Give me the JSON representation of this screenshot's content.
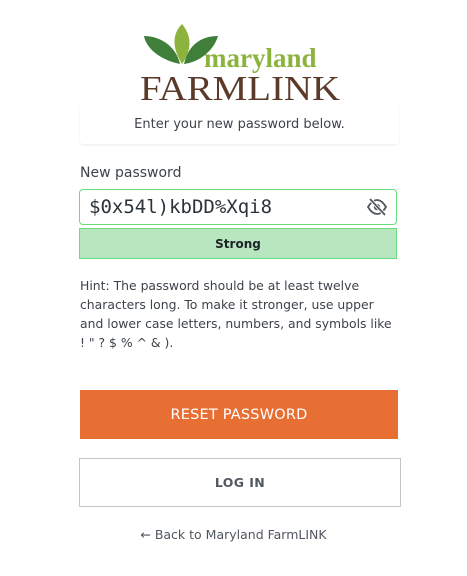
{
  "logo": {
    "word_top": "maryland",
    "word_bottom": "FARMLINK",
    "top_color": "#8db33f",
    "bottom_color": "#5b3a29",
    "leaf_dark": "#3f7f3a",
    "leaf_light": "#8db33f"
  },
  "message": "Enter your new password below.",
  "password": {
    "label": "New password",
    "value": "$0x54l)kbDD%Xqi8",
    "toggle_icon": "eye-slash-icon"
  },
  "strength": {
    "label": "Strong",
    "color": "#b8e6bf"
  },
  "hint": "Hint: The password should be at least twelve characters long. To make it stronger, use upper and lower case letters, numbers, and symbols like ! \" ? $ % ^ & ).",
  "buttons": {
    "reset": "RESET PASSWORD",
    "reset_color": "#e86f33",
    "login": "LOG IN"
  },
  "back_link": "← Back to Maryland FarmLINK"
}
